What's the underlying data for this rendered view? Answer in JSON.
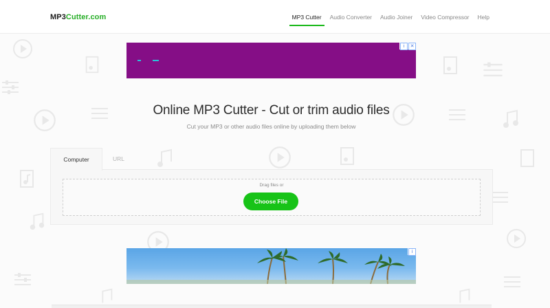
{
  "header": {
    "logo_part1": "MP3",
    "logo_part2": "Cutter.com",
    "nav": [
      {
        "label": "MP3 Cutter",
        "active": true
      },
      {
        "label": "Audio Converter",
        "active": false
      },
      {
        "label": "Audio Joiner",
        "active": false
      },
      {
        "label": "Video Compressor",
        "active": false
      },
      {
        "label": "Help",
        "active": false
      }
    ]
  },
  "main": {
    "title": "Online MP3 Cutter - Cut or trim audio files",
    "subtitle": "Cut your MP3 or other audio files online by uploading them below"
  },
  "upload": {
    "tabs": [
      {
        "label": "Computer",
        "active": true
      },
      {
        "label": "URL",
        "active": false
      }
    ],
    "drag_text": "Drag files or",
    "choose_button": "Choose File"
  },
  "ads": {
    "close_icon": "close-icon",
    "info_icon": "info-icon"
  },
  "colors": {
    "accent": "#17c317",
    "logo_green": "#27ae27",
    "top_ad_bg": "#850e86"
  }
}
